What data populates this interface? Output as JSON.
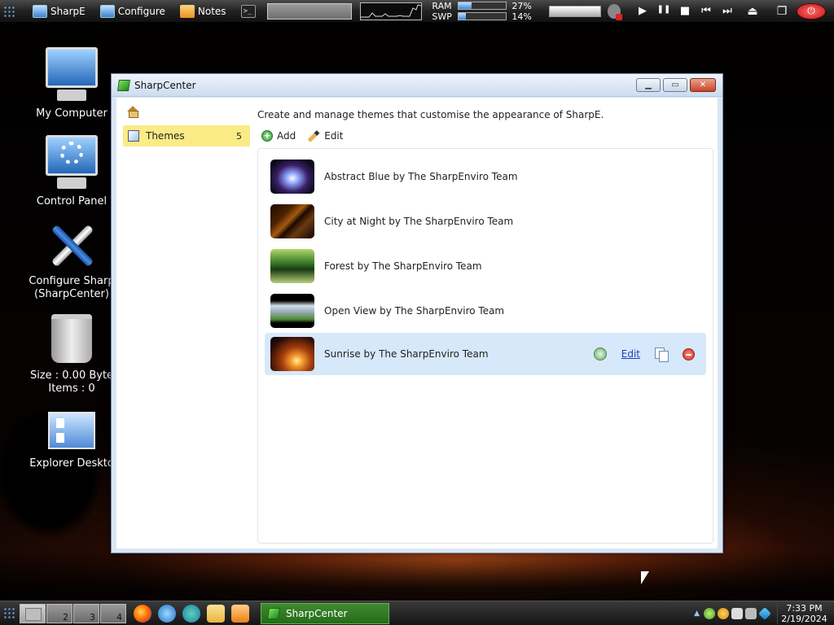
{
  "topbar": {
    "sharpe_label": "SharpE",
    "configure_label": "Configure",
    "notes_label": "Notes",
    "console_glyph": ">_",
    "ram_label": "RAM",
    "ram_value": "27%",
    "ram_fraction": 0.27,
    "swp_label": "SWP",
    "swp_value": "14%",
    "swp_fraction": 0.14,
    "media": {
      "play": "▶",
      "pause": "❚❚",
      "stop": "■",
      "prev": "⏮",
      "next": "⏭"
    },
    "power_glyph": "⏻"
  },
  "desktop_icons": [
    {
      "label": "My Computer"
    },
    {
      "label": "Control Panel"
    },
    {
      "label": "Configure Sharp\n(SharpCenter)"
    },
    {
      "label": "Size : 0.00 Byte\nItems : 0"
    },
    {
      "label": "Explorer Deskto"
    }
  ],
  "window": {
    "title": "SharpCenter",
    "controls": {
      "minimize": "▁",
      "maximize": "▭",
      "close": "✕"
    },
    "sidebar": {
      "items": [
        {
          "label": "Themes",
          "count": "5"
        }
      ]
    },
    "description": "Create and manage themes that customise the appearance of SharpE.",
    "actions": {
      "add": "Add",
      "edit": "Edit"
    },
    "themes": [
      {
        "name": "Abstract Blue by The SharpEnviro Team"
      },
      {
        "name": "City at Night by The SharpEnviro Team"
      },
      {
        "name": "Forest by The SharpEnviro Team"
      },
      {
        "name": "Open View by The SharpEnviro Team"
      },
      {
        "name": "Sunrise by The SharpEnviro Team",
        "selected": true,
        "edit_label": "Edit"
      }
    ]
  },
  "taskbar": {
    "desktops": [
      "",
      "2",
      "3",
      "4"
    ],
    "quicklaunch": [
      "firefox-icon",
      "internet-explorer-icon",
      "edge-icon",
      "folder-icon",
      "media-player-icon"
    ],
    "active_task": "SharpCenter",
    "tray_arrow": "▲",
    "clock_time": "7:33 PM",
    "clock_date": "2/19/2024"
  },
  "colors": {
    "selected_sidebar": "#fbeb86",
    "selected_row": "#d6e8fa",
    "link": "#1f3fb5",
    "task_active": "#3f8a2f"
  }
}
